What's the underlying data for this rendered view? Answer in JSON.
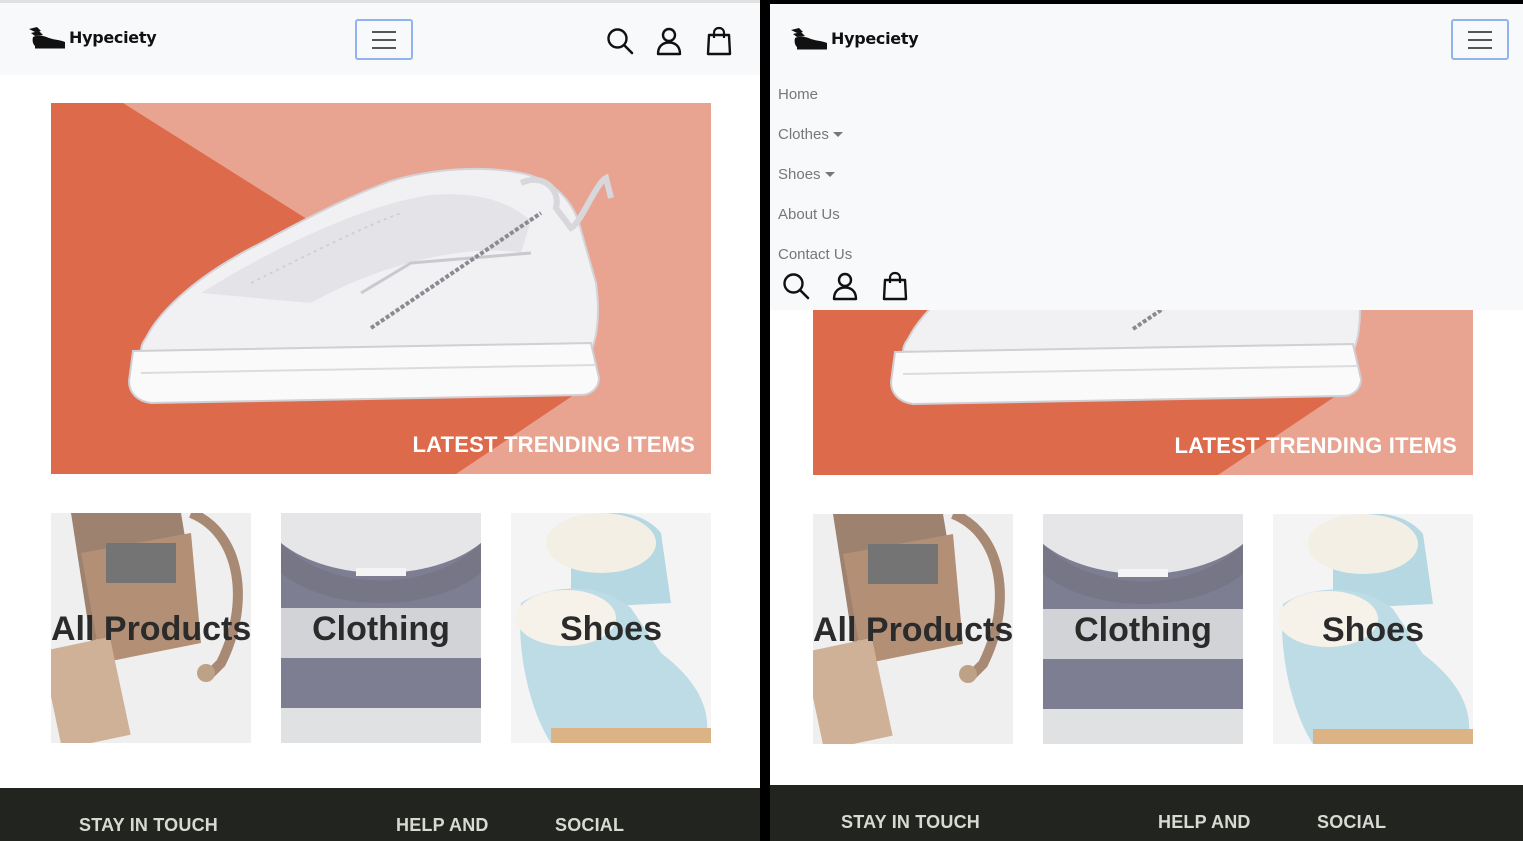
{
  "brand": {
    "name": "Hypeciety"
  },
  "nav": {
    "items": [
      {
        "label": "Home",
        "dropdown": false
      },
      {
        "label": "Clothes",
        "dropdown": true
      },
      {
        "label": "Shoes",
        "dropdown": true
      },
      {
        "label": "About Us",
        "dropdown": false
      },
      {
        "label": "Contact Us",
        "dropdown": false
      }
    ],
    "icons": [
      "search-icon",
      "user-icon",
      "shopping-bag-icon"
    ]
  },
  "hero": {
    "caption": "LATEST TRENDING ITEMS"
  },
  "categories": [
    {
      "label": "All Products"
    },
    {
      "label": "Clothing"
    },
    {
      "label": "Shoes"
    }
  ],
  "footer": {
    "headings": [
      "STAY IN TOUCH",
      "HELP AND",
      "SOCIAL"
    ]
  },
  "colors": {
    "hero_orange": "#de6a4c",
    "hero_pink": "#e8a491",
    "navbar_bg": "#f8f9fa",
    "footer_bg": "#22241f",
    "toggler_border": "#8fb4ee"
  }
}
